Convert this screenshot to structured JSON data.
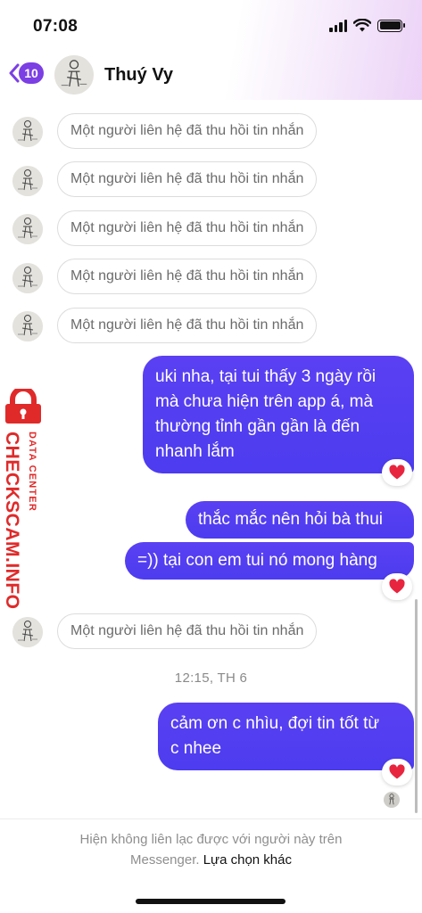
{
  "status_bar": {
    "time": "07:08"
  },
  "header": {
    "back_badge": "10",
    "contact_name": "Thuý Vy"
  },
  "recalled_top": [
    {
      "text": "Một người liên hệ đã thu hồi tin nhắn"
    },
    {
      "text": "Một người liên hệ đã thu hồi tin nhắn"
    },
    {
      "text": "Một người liên hệ đã thu hồi tin nhắn"
    },
    {
      "text": "Một người liên hệ đã thu hồi tin nhắn"
    },
    {
      "text": "Một người liên hệ đã thu hồi tin nhắn"
    }
  ],
  "outgoing": [
    {
      "lines": [
        "uki nha, tại tui thấy 3 ngày rồi",
        "mà chưa hiện trên app á, mà",
        "thường tỉnh gần gần là đến",
        "nhanh lắm"
      ],
      "reaction": "heart"
    },
    {
      "lines": [
        "thắc mắc nên hỏi bà thui"
      ]
    },
    {
      "lines": [
        "=)) tại con em tui nó mong hàng"
      ],
      "reaction": "heart"
    },
    {
      "lines": [
        "cảm ơn c nhìu, đợi tin tốt từ",
        "c nhee"
      ],
      "reaction": "heart"
    }
  ],
  "recalled_bottom": {
    "text": "Một người liên hệ đã thu hồi tin nhắn"
  },
  "timestamp": "12:15, TH 6",
  "footer": {
    "text": "Hiện không liên lạc được với người này trên",
    "text2": "Messenger.",
    "link": "Lựa chọn khác"
  },
  "watermark": {
    "small": "DATA CENTER",
    "big": "CHECKSCAM.INFO"
  },
  "colors": {
    "bubble": "#5040f0",
    "badge": "#7b3fe4",
    "heart": "#e8253f"
  }
}
